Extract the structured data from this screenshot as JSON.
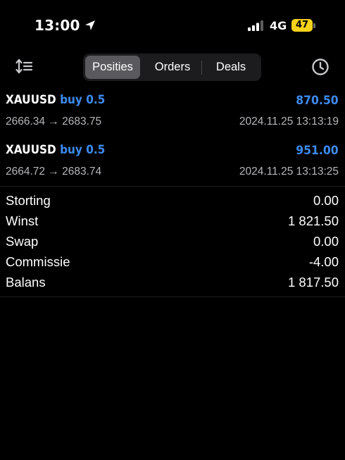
{
  "status_bar": {
    "time": "13:00",
    "location_icon": "location-arrow-icon",
    "signal_icon": "cellular-signal-icon",
    "network": "4G",
    "battery_level": "47",
    "battery_color": "#f7d21a"
  },
  "toolbar": {
    "sort_icon": "sort-order-icon",
    "history_icon": "clock-history-icon",
    "tabs": [
      {
        "label": "Posities",
        "selected": true
      },
      {
        "label": "Orders",
        "selected": false
      },
      {
        "label": "Deals",
        "selected": false
      }
    ]
  },
  "positions": [
    {
      "symbol": "XAUUSD",
      "type": "buy 0.5",
      "profit": "870.50",
      "prices": "2666.34 → 2683.75",
      "datetime": "2024.11.25 13:13:19"
    },
    {
      "symbol": "XAUUSD",
      "type": "buy 0.5",
      "profit": "951.00",
      "prices": "2664.72 → 2683.74",
      "datetime": "2024.11.25 13:13:25"
    }
  ],
  "summary": [
    {
      "label": "Storting",
      "value": "0.00"
    },
    {
      "label": "Winst",
      "value": "1 821.50"
    },
    {
      "label": "Swap",
      "value": "0.00"
    },
    {
      "label": "Commissie",
      "value": "-4.00"
    },
    {
      "label": "Balans",
      "value": "1 817.50"
    }
  ],
  "colors": {
    "background": "#000000",
    "accent_blue": "#3d8bf0",
    "secondary_text": "#b6b6bb",
    "segment_selected": "#5a5a5e"
  }
}
